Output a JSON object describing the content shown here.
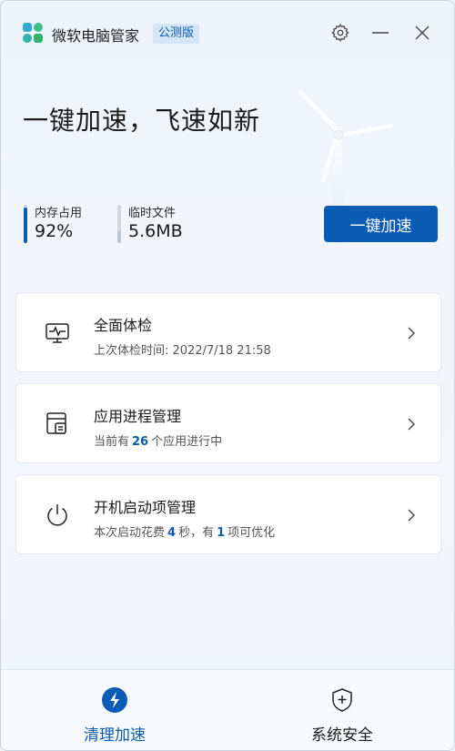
{
  "app": {
    "title": "微软电脑管家",
    "badge": "公测版"
  },
  "titlebar": {
    "icons": [
      "settings-gear-icon",
      "minimize-icon",
      "close-icon"
    ]
  },
  "hero": {
    "title": "一键加速，飞速如新",
    "memory": {
      "label": "内存占用",
      "value": "92%",
      "level": 0.92
    },
    "tempfiles": {
      "label": "临时文件",
      "value": "5.6MB",
      "level": 0.3
    },
    "boost_button": "一键加速"
  },
  "cards": [
    {
      "title": "全面体检",
      "subtitle": "上次体检时间: 2022/7/18 21:58",
      "icon": "health-check-icon"
    },
    {
      "title": "应用进程管理",
      "subtitle_pre": "当前有",
      "count": "26",
      "subtitle_post": "个应用进行中",
      "icon": "process-manager-icon"
    },
    {
      "title": "开机启动项管理",
      "sub_a": "本次启动花费",
      "seconds": "4",
      "sub_b": "秒，有",
      "items": "1",
      "sub_c": "项可优化",
      "icon": "power-icon"
    }
  ],
  "nav": {
    "clean": {
      "label": "清理加速",
      "active": true
    },
    "security": {
      "label": "系统安全",
      "active": false
    }
  },
  "colors": {
    "accent": "#0b5cb4",
    "logo": [
      "#2fa8d8",
      "#3cc08a",
      "#2fb4a6",
      "#34b36f"
    ]
  }
}
